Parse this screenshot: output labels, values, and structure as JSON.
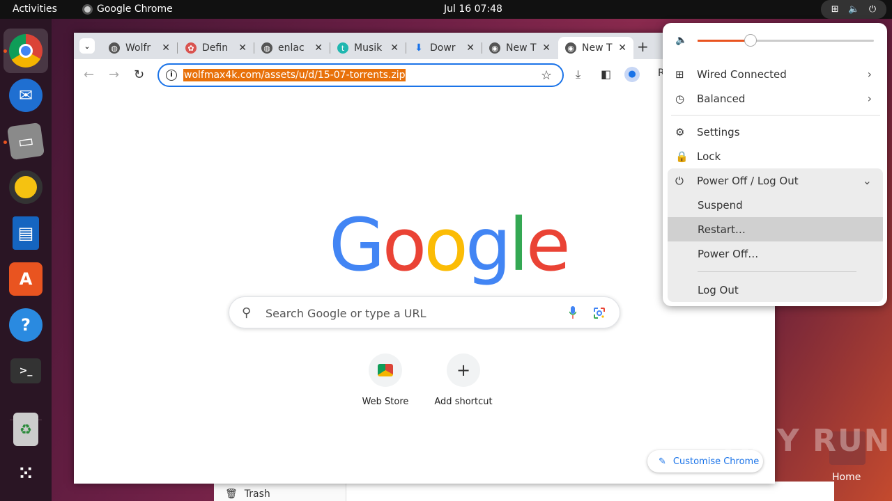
{
  "topbar": {
    "activities": "Activities",
    "app_name": "Google Chrome",
    "clock": "Jul 16  07:48"
  },
  "dock": {
    "items": [
      "chrome-icon",
      "thunderbird-icon",
      "files-icon",
      "rhythmbox-icon",
      "writer-icon",
      "software-icon",
      "help-icon",
      "terminal-icon",
      "trash-icon",
      "apps-grid-icon"
    ]
  },
  "chrome": {
    "tabs": [
      {
        "title": "Wolfr",
        "icon": "globe-icon"
      },
      {
        "title": "Defin",
        "icon": "puzzle-icon"
      },
      {
        "title": "enlac",
        "icon": "globe-icon"
      },
      {
        "title": "Musik",
        "icon": "t-icon"
      },
      {
        "title": "Dowr",
        "icon": "download-icon"
      },
      {
        "title": "New T",
        "icon": "chrome-logo-icon"
      },
      {
        "title": "New T",
        "icon": "chrome-logo-icon"
      }
    ],
    "url": "wolfmax4k.com/assets/u/d/15-07-torrents.zip",
    "profile_initial": "R",
    "search_placeholder": "Search Google or type a URL",
    "logo": {
      "G": "G",
      "o1": "o",
      "o2": "o",
      "g": "g",
      "l": "l",
      "e": "e"
    },
    "shortcuts": [
      {
        "label": "Web Store"
      },
      {
        "label": "Add shortcut",
        "glyph": "+"
      }
    ],
    "customize": "Customise Chrome"
  },
  "quick_settings": {
    "volume": 0.3,
    "network": "Wired Connected",
    "power_mode": "Balanced",
    "settings": "Settings",
    "lock": "Lock",
    "power_menu": "Power Off / Log Out",
    "suspend": "Suspend",
    "restart": "Restart…",
    "power_off": "Power Off…",
    "log_out": "Log Out"
  },
  "desktop": {
    "files_trash": "Trash",
    "home_label": "Home",
    "watermark": "ANY RUN"
  },
  "colors": {
    "accent": "#e95420",
    "chrome_blue": "#1a73e8",
    "url_highlight": "#e8710a"
  }
}
